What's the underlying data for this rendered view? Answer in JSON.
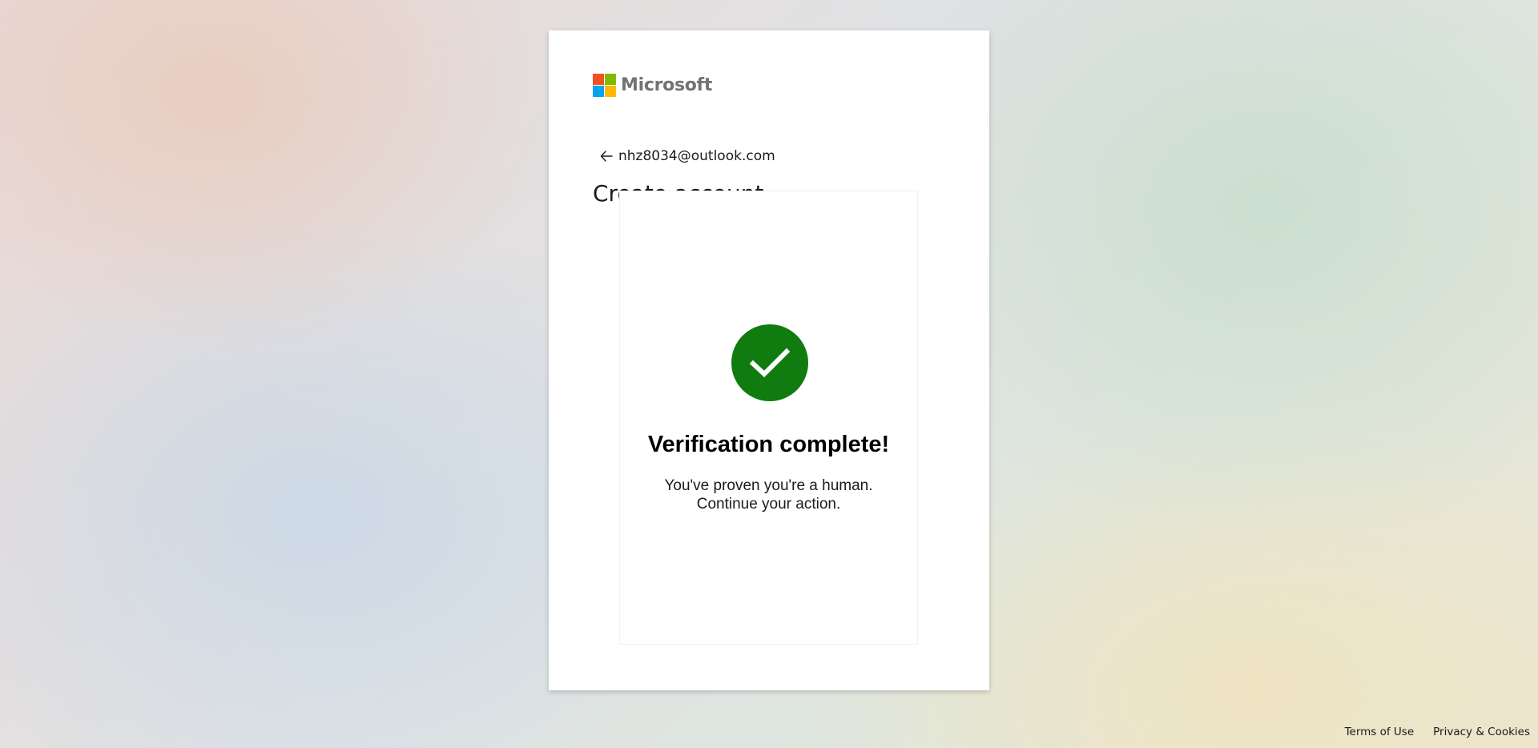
{
  "brand": {
    "name": "Microsoft",
    "logo_colors": [
      "#f25022",
      "#7fba00",
      "#00a4ef",
      "#ffb900"
    ]
  },
  "identity": {
    "back_icon": "arrow-left-icon",
    "email": "nhz8034@outlook.com"
  },
  "page": {
    "title": "Create account"
  },
  "challenge": {
    "status_icon": "checkmark-circle-icon",
    "status_color": "#107c10",
    "title": "Verification complete!",
    "message_line1": "You've proven you're a human.",
    "message_line2": "Continue your action."
  },
  "footer": {
    "terms_label": "Terms of Use",
    "privacy_label": "Privacy & Cookies"
  }
}
